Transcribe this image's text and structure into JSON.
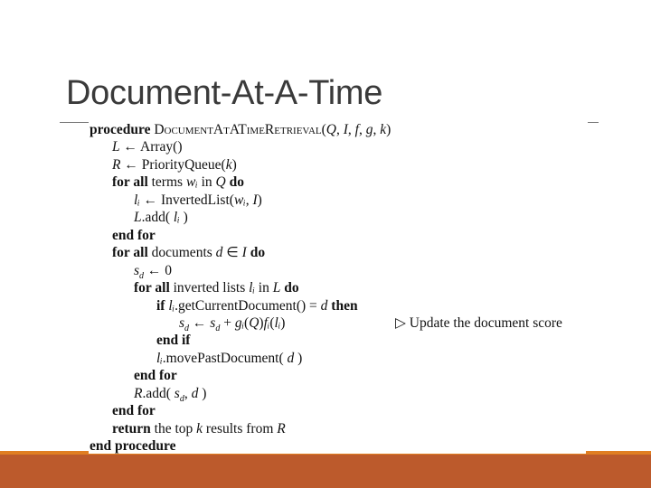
{
  "slide": {
    "title": "Document-At-A-Time"
  },
  "algorithm": {
    "lines": [
      {
        "indent": 0,
        "segs": [
          {
            "t": "procedure ",
            "s": "b"
          },
          {
            "t": "DocumentAtATimeRetrieval",
            "s": "sc"
          },
          {
            "t": "(",
            "s": "r"
          },
          {
            "t": "Q",
            "s": "i"
          },
          {
            "t": ", ",
            "s": "r"
          },
          {
            "t": "I",
            "s": "i"
          },
          {
            "t": ", ",
            "s": "r"
          },
          {
            "t": "f",
            "s": "i"
          },
          {
            "t": ", ",
            "s": "r"
          },
          {
            "t": "g",
            "s": "i"
          },
          {
            "t": ", ",
            "s": "r"
          },
          {
            "t": "k",
            "s": "i"
          },
          {
            "t": ")",
            "s": "r"
          }
        ]
      },
      {
        "indent": 1,
        "segs": [
          {
            "t": "L",
            "s": "i"
          },
          {
            "t": " ← Array()",
            "s": "r"
          }
        ]
      },
      {
        "indent": 1,
        "segs": [
          {
            "t": "R",
            "s": "i"
          },
          {
            "t": " ← PriorityQueue(",
            "s": "r"
          },
          {
            "t": "k",
            "s": "i"
          },
          {
            "t": ")",
            "s": "r"
          }
        ]
      },
      {
        "indent": 1,
        "segs": [
          {
            "t": "for all",
            "s": "b"
          },
          {
            "t": " terms ",
            "s": "r"
          },
          {
            "t": "wᵢ",
            "s": "i"
          },
          {
            "t": " in ",
            "s": "r"
          },
          {
            "t": "Q",
            "s": "i"
          },
          {
            "t": " do",
            "s": "b"
          }
        ]
      },
      {
        "indent": 2,
        "segs": [
          {
            "t": "lᵢ",
            "s": "i"
          },
          {
            "t": " ← InvertedList(",
            "s": "r"
          },
          {
            "t": "wᵢ",
            "s": "i"
          },
          {
            "t": ", ",
            "s": "r"
          },
          {
            "t": "I",
            "s": "i"
          },
          {
            "t": ")",
            "s": "r"
          }
        ]
      },
      {
        "indent": 2,
        "segs": [
          {
            "t": "L",
            "s": "i"
          },
          {
            "t": ".add( ",
            "s": "r"
          },
          {
            "t": "lᵢ",
            "s": "i"
          },
          {
            "t": " )",
            "s": "r"
          }
        ]
      },
      {
        "indent": 1,
        "segs": [
          {
            "t": "end for",
            "s": "b"
          }
        ]
      },
      {
        "indent": 1,
        "segs": [
          {
            "t": "for all",
            "s": "b"
          },
          {
            "t": " documents ",
            "s": "r"
          },
          {
            "t": "d",
            "s": "i"
          },
          {
            "t": " ∈ ",
            "s": "r"
          },
          {
            "t": "I",
            "s": "i"
          },
          {
            "t": " do",
            "s": "b"
          }
        ]
      },
      {
        "indent": 2,
        "segs": [
          {
            "t": "s_d",
            "s": "i"
          },
          {
            "t": " ← 0",
            "s": "r"
          }
        ]
      },
      {
        "indent": 2,
        "segs": [
          {
            "t": "for all",
            "s": "b"
          },
          {
            "t": " inverted lists ",
            "s": "r"
          },
          {
            "t": "lᵢ",
            "s": "i"
          },
          {
            "t": " in ",
            "s": "r"
          },
          {
            "t": "L",
            "s": "i"
          },
          {
            "t": " do",
            "s": "b"
          }
        ]
      },
      {
        "indent": 3,
        "segs": [
          {
            "t": "if ",
            "s": "b"
          },
          {
            "t": "lᵢ",
            "s": "i"
          },
          {
            "t": ".getCurrentDocument() = ",
            "s": "r"
          },
          {
            "t": "d",
            "s": "i"
          },
          {
            "t": " then",
            "s": "b"
          }
        ]
      },
      {
        "indent": 4,
        "segs": [
          {
            "t": "s_d",
            "s": "i"
          },
          {
            "t": " ← ",
            "s": "r"
          },
          {
            "t": "s_d",
            "s": "i"
          },
          {
            "t": " + ",
            "s": "r"
          },
          {
            "t": "gᵢ",
            "s": "i"
          },
          {
            "t": "(",
            "s": "r"
          },
          {
            "t": "Q",
            "s": "i"
          },
          {
            "t": ")",
            "s": "r"
          },
          {
            "t": "fᵢ",
            "s": "i"
          },
          {
            "t": "(",
            "s": "r"
          },
          {
            "t": "lᵢ",
            "s": "i"
          },
          {
            "t": ")",
            "s": "r"
          }
        ],
        "comment": "▷ Update the document score"
      },
      {
        "indent": 3,
        "segs": [
          {
            "t": "end if",
            "s": "b"
          }
        ]
      },
      {
        "indent": 3,
        "segs": [
          {
            "t": "lᵢ",
            "s": "i"
          },
          {
            "t": ".movePastDocument( ",
            "s": "r"
          },
          {
            "t": "d",
            "s": "i"
          },
          {
            "t": " )",
            "s": "r"
          }
        ]
      },
      {
        "indent": 2,
        "segs": [
          {
            "t": "end for",
            "s": "b"
          }
        ]
      },
      {
        "indent": 2,
        "segs": [
          {
            "t": "R",
            "s": "i"
          },
          {
            "t": ".add( ",
            "s": "r"
          },
          {
            "t": "s_d",
            "s": "i"
          },
          {
            "t": ", ",
            "s": "r"
          },
          {
            "t": "d",
            "s": "i"
          },
          {
            "t": " )",
            "s": "r"
          }
        ]
      },
      {
        "indent": 1,
        "segs": [
          {
            "t": "end for",
            "s": "b"
          }
        ]
      },
      {
        "indent": 1,
        "segs": [
          {
            "t": "return",
            "s": "b"
          },
          {
            "t": " the top ",
            "s": "r"
          },
          {
            "t": "k",
            "s": "i"
          },
          {
            "t": " results from ",
            "s": "r"
          },
          {
            "t": "R",
            "s": "i"
          }
        ]
      },
      {
        "indent": 0,
        "segs": [
          {
            "t": "end procedure",
            "s": "b"
          }
        ]
      }
    ]
  },
  "colors": {
    "accent_line": "#e07e22",
    "footer_bar": "#bc5a2c",
    "title_text": "#3a3a3a"
  }
}
